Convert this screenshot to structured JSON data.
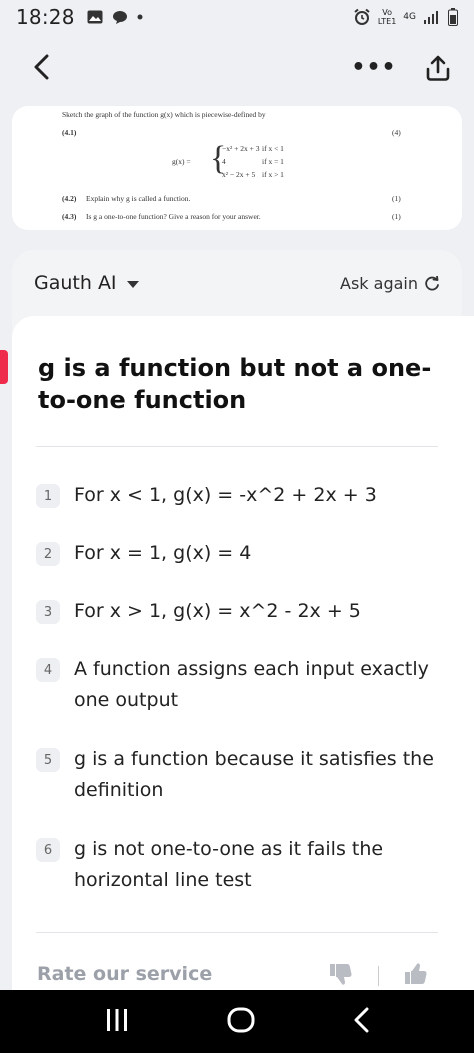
{
  "status_bar": {
    "time": "18:28",
    "network_label": "4G",
    "volte_label": "Vo\nLTE1",
    "icons": [
      "gallery-icon",
      "chat-bubble-icon",
      "dot-icon",
      "alarm-icon",
      "signal-icon",
      "battery-icon"
    ]
  },
  "nav": {
    "back_icon": "chevron-left-icon",
    "more_label": "•••",
    "share_icon": "share-icon"
  },
  "question": {
    "title": "Sketch the graph of the function g(x) which is piecewise-defined by",
    "q41": "(4.1)",
    "q41_marks": "(4)",
    "func_lhs": "g(x) =",
    "cases": [
      "−x² + 2x + 3",
      "4",
      "x² − 2x + 5"
    ],
    "conditions": [
      "if x < 1",
      "if x = 1",
      "if x > 1"
    ],
    "q42": "(4.2)",
    "q42_text": "Explain why g is called a function.",
    "q42_marks": "(1)",
    "q43": "(4.3)",
    "q43_text": "Is g a one-to-one function? Give a reason for your answer.",
    "q43_marks": "(1)"
  },
  "answer_panel": {
    "brand": "Gauth AI",
    "ask_again": "Ask again",
    "headline": "g is a function but not a one-to-one function",
    "steps": [
      {
        "num": "1",
        "text": "For x < 1, g(x) = -x^2 + 2x + 3"
      },
      {
        "num": "2",
        "text": "For x = 1, g(x) = 4"
      },
      {
        "num": "3",
        "text": "For x > 1, g(x) = x^2 - 2x + 5"
      },
      {
        "num": "4",
        "text": "A function assigns each input exactly one output"
      },
      {
        "num": "5",
        "text": "g is a function because it satisfies the definition"
      },
      {
        "num": "6",
        "text": "g is not one-to-one as it fails the horizontal line test"
      }
    ],
    "rate_label": "Rate our service"
  },
  "colors": {
    "accent": "#ef2b4c",
    "background": "#eef0f3"
  }
}
